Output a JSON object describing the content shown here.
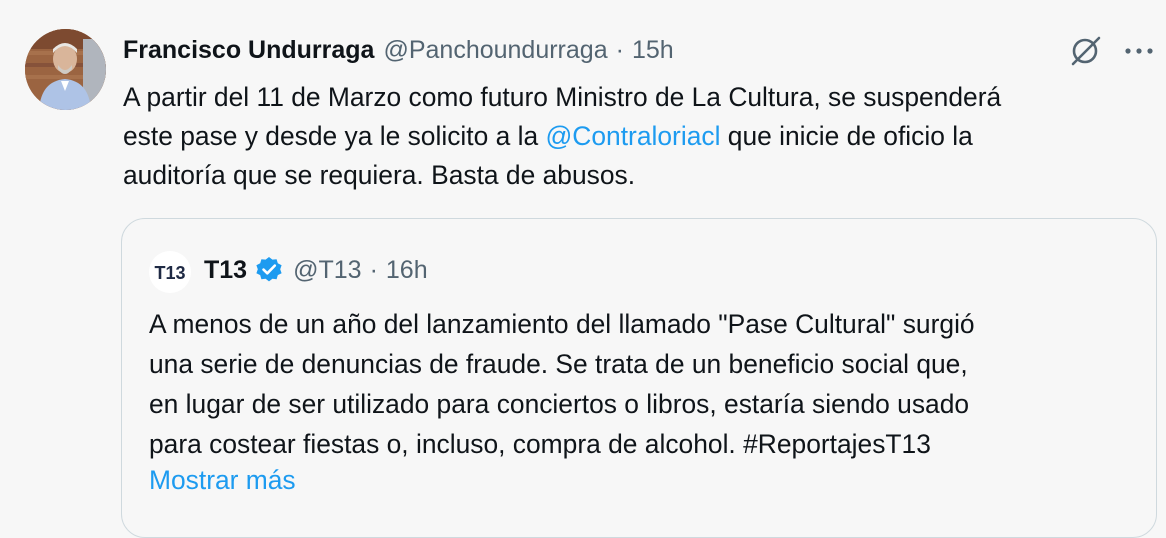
{
  "tweet": {
    "author_name": "Francisco Undurraga",
    "author_handle": "@Panchoundurraga",
    "separator": "·",
    "time": "15h",
    "lines": [
      {
        "before": "A partir del 11 de Marzo como futuro Ministro de La Cultura, se suspenderá",
        "mention": "",
        "after": ""
      },
      {
        "before": "este pase y desde ya le solicito a la ",
        "mention": "@Contraloriacl",
        "after": " que inicie de oficio la"
      },
      {
        "before": "auditoría que se requiera. Basta de abusos.",
        "mention": "",
        "after": ""
      }
    ],
    "icons": {
      "grok": "grok-icon",
      "more": "more-horizontal-icon"
    }
  },
  "quoted": {
    "author_name": "T13",
    "avatar_text": "T13",
    "author_handle": "@T13",
    "separator": "·",
    "time": "16h",
    "verified_icon": "verified-badge-icon",
    "lines": [
      "A menos de un año del lanzamiento del llamado \"Pase Cultural\" surgió",
      "una serie de denuncias de fraude. Se trata de un beneficio social que,",
      "en lugar de ser utilizado para conciertos o libros, estaría siendo usado",
      "para costear fiestas o, incluso, compra de alcohol. #ReportajesT13"
    ],
    "show_more": "Mostrar más"
  },
  "colors": {
    "background": "#f7f7f7",
    "text": "#0f1419",
    "secondary_text": "#536471",
    "link": "#1d9bf0",
    "verified": "#1d9bf0",
    "border": "#cfd9de",
    "t13_orange": "#ef6c2f"
  }
}
